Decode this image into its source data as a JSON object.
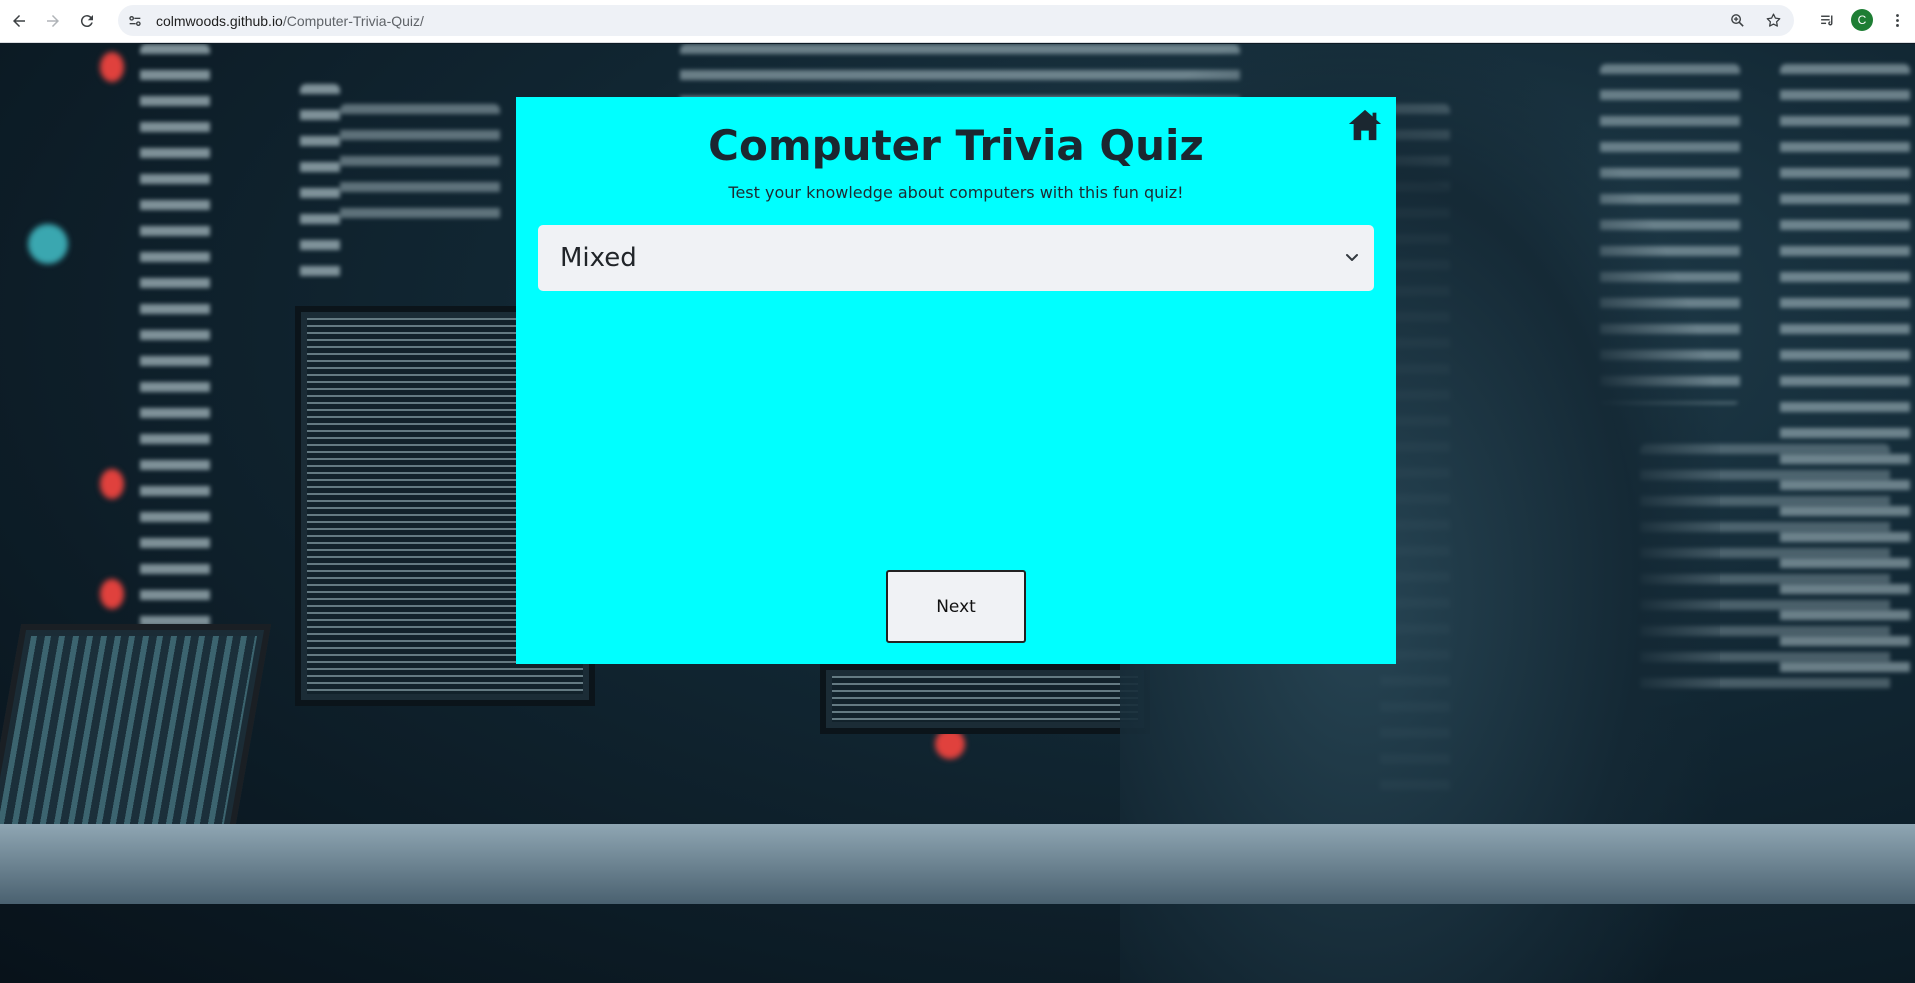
{
  "browser": {
    "url_host": "colmwoods.github.io",
    "url_path": "/Computer-Trivia-Quiz/",
    "profile_initial": "C",
    "profile_color": "#1e7e34"
  },
  "quiz": {
    "title": "Computer Trivia Quiz",
    "subtitle": "Test your knowledge about computers with this fun quiz!",
    "category_selected": "Mixed",
    "next_label": "Next",
    "card_color": "#00ffff"
  }
}
